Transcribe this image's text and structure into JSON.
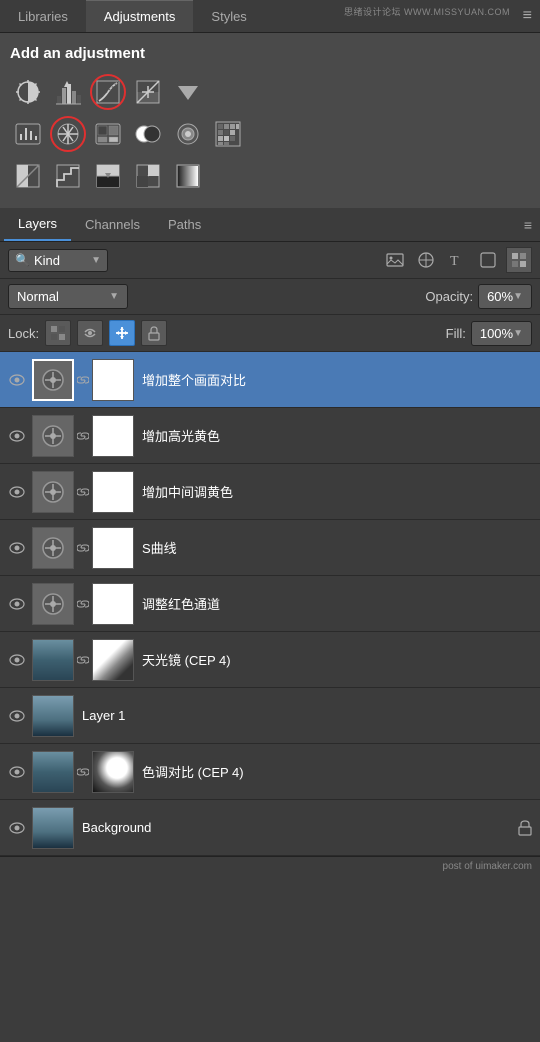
{
  "header": {
    "tabs": [
      "Libraries",
      "Adjustments",
      "Styles"
    ],
    "active_tab": "Adjustments",
    "menu_icon": "≡",
    "watermark": "思绪设计论坛 WWW.MISSYUAN.COM"
  },
  "adjustments": {
    "title": "Add an adjustment",
    "icons_row1": [
      {
        "name": "brightness-contrast-icon",
        "label": "Brightness/Contrast",
        "highlighted": false
      },
      {
        "name": "levels-icon",
        "label": "Levels",
        "highlighted": false
      },
      {
        "name": "curves-icon",
        "label": "Curves",
        "highlighted": true
      },
      {
        "name": "exposure-icon",
        "label": "Exposure",
        "highlighted": false
      },
      {
        "name": "dropdown-icon",
        "label": "More",
        "highlighted": false
      }
    ],
    "icons_row2": [
      {
        "name": "vibrance-icon",
        "label": "Vibrance",
        "highlighted": false
      },
      {
        "name": "hue-saturation-icon",
        "label": "Hue/Saturation",
        "highlighted": true
      },
      {
        "name": "color-balance-icon",
        "label": "Color Balance",
        "highlighted": false
      },
      {
        "name": "bw-icon",
        "label": "Black & White",
        "highlighted": false
      },
      {
        "name": "photo-filter-icon",
        "label": "Photo Filter",
        "highlighted": false
      },
      {
        "name": "channel-mixer-icon",
        "label": "Channel Mixer",
        "highlighted": false
      }
    ],
    "icons_row3": [
      {
        "name": "invert-icon",
        "label": "Invert",
        "highlighted": false
      },
      {
        "name": "posterize-icon",
        "label": "Posterize",
        "highlighted": false
      },
      {
        "name": "threshold-icon",
        "label": "Threshold",
        "highlighted": false
      },
      {
        "name": "selective-color-icon",
        "label": "Selective Color",
        "highlighted": false
      },
      {
        "name": "gradient-map-icon",
        "label": "Gradient Map",
        "highlighted": false
      }
    ]
  },
  "sub_tabs": {
    "tabs": [
      "Layers",
      "Channels",
      "Paths"
    ],
    "active_tab": "Layers"
  },
  "kind_row": {
    "search_placeholder": "🔍",
    "kind_label": "Kind",
    "icons": [
      "image-filter-icon",
      "circle-filter-icon",
      "text-filter-icon",
      "shape-filter-icon",
      "smart-filter-icon"
    ],
    "pixel_icon": "▦"
  },
  "blend_row": {
    "blend_mode": "Normal",
    "opacity_label": "Opacity:",
    "opacity_value": "60%"
  },
  "lock_row": {
    "lock_label": "Lock:",
    "lock_icons": [
      "checkerboard-lock",
      "brush-lock",
      "move-lock",
      "padlock-lock"
    ],
    "fill_label": "Fill:",
    "fill_value": "100%"
  },
  "layers": [
    {
      "id": 1,
      "visible": true,
      "type": "adjustment",
      "adj_symbol": "⊘",
      "has_mask": true,
      "mask_type": "white",
      "name": "增加整个画面对比",
      "selected": true
    },
    {
      "id": 2,
      "visible": true,
      "type": "adjustment",
      "adj_symbol": "⊘",
      "has_mask": true,
      "mask_type": "white",
      "name": "增加高光黄色",
      "selected": false
    },
    {
      "id": 3,
      "visible": true,
      "type": "adjustment",
      "adj_symbol": "⊘",
      "has_mask": true,
      "mask_type": "white",
      "name": "增加中间调黄色",
      "selected": false
    },
    {
      "id": 4,
      "visible": true,
      "type": "adjustment",
      "adj_symbol": "⊘",
      "has_mask": true,
      "mask_type": "white",
      "name": "S曲线",
      "selected": false
    },
    {
      "id": 5,
      "visible": true,
      "type": "adjustment",
      "adj_symbol": "⊘",
      "has_mask": true,
      "mask_type": "white",
      "name": "调整红色通道",
      "selected": false
    },
    {
      "id": 6,
      "visible": true,
      "type": "image",
      "has_mask": true,
      "mask_type": "cloud",
      "name": "天光镜 (CEP 4)",
      "selected": false
    },
    {
      "id": 7,
      "visible": true,
      "type": "image",
      "has_mask": false,
      "name": "Layer 1",
      "selected": false
    },
    {
      "id": 8,
      "visible": true,
      "type": "image",
      "has_mask": true,
      "mask_type": "cloud2",
      "name": "色调对比 (CEP 4)",
      "selected": false
    },
    {
      "id": 9,
      "visible": true,
      "type": "image",
      "has_mask": false,
      "has_lock": true,
      "name": "Background",
      "selected": false
    }
  ],
  "footer": {
    "text": "post of uimaker.com"
  }
}
